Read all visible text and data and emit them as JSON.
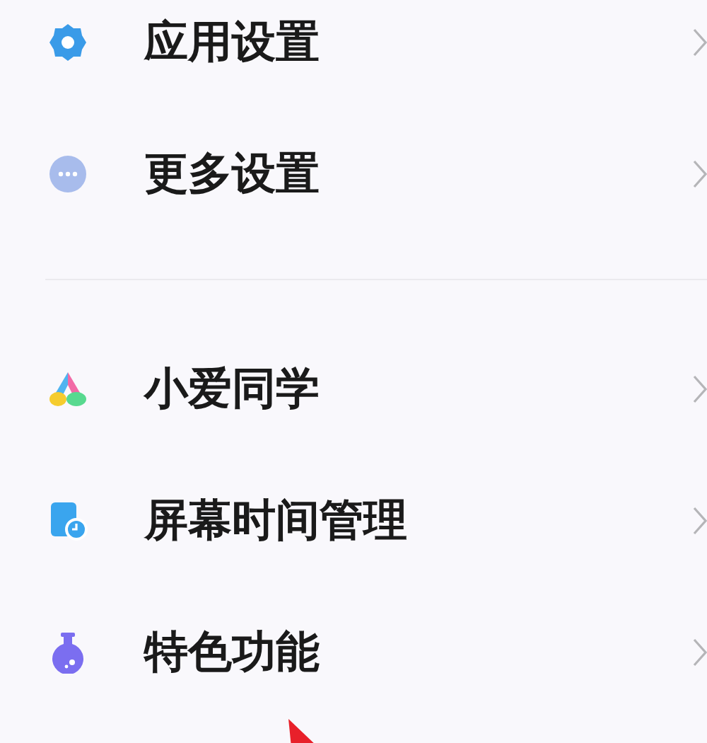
{
  "groups": [
    {
      "items": [
        {
          "kind": "gear",
          "label": "应用设置"
        },
        {
          "kind": "more",
          "label": "更多设置"
        }
      ]
    },
    {
      "items": [
        {
          "kind": "assistant",
          "label": "小爱同学"
        },
        {
          "kind": "screen-time",
          "label": "屏幕时间管理"
        },
        {
          "kind": "flask",
          "label": "特色功能"
        }
      ]
    }
  ]
}
